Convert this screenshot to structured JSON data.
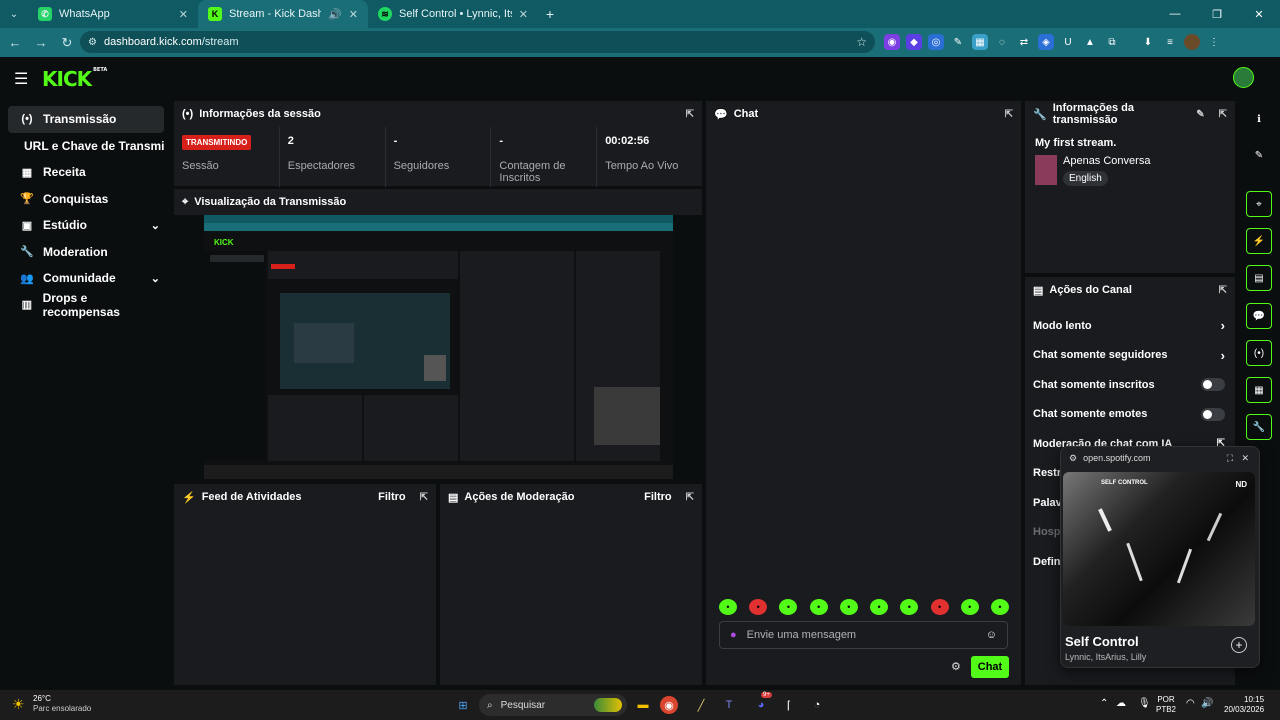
{
  "browser": {
    "tabs": [
      {
        "title": "WhatsApp",
        "icon": "whatsapp-icon",
        "color": "#25d366"
      },
      {
        "title": "Stream - Kick Dashboard",
        "icon": "kick-icon",
        "color": "#53fc18"
      },
      {
        "title": "Self Control • Lynnic, ItsAriu",
        "icon": "spotify-icon",
        "color": "#1ed760"
      }
    ],
    "new_tab": "+",
    "url_host": "dashboard.kick.com",
    "url_path": "/stream"
  },
  "header": {
    "logo": "KICK",
    "logo_badge": "BETA"
  },
  "sidebar": {
    "items": [
      {
        "label": "Transmissão",
        "icon": "(•)"
      },
      {
        "label": "URL e Chave de Transmissão",
        "icon": ""
      },
      {
        "label": "Receita",
        "icon": "▦"
      },
      {
        "label": "Conquistas",
        "icon": "🏆"
      },
      {
        "label": "Estúdio",
        "icon": "▣",
        "chevron": "⌄"
      },
      {
        "label": "Moderation",
        "icon": "🔧"
      },
      {
        "label": "Comunidade",
        "icon": "👥",
        "chevron": "⌄"
      },
      {
        "label": "Drops e recompensas",
        "icon": "▥"
      }
    ]
  },
  "session": {
    "title": "Informações da sessão",
    "live_badge": "TRANSMITINDO",
    "stats": [
      {
        "value": "",
        "label": "Sessão"
      },
      {
        "value": "2",
        "label": "Espectadores"
      },
      {
        "value": "-",
        "label": "Seguidores"
      },
      {
        "value": "-",
        "label": "Contagem de Inscritos"
      },
      {
        "value": "00:02:56",
        "label": "Tempo Ao Vivo"
      }
    ]
  },
  "preview": {
    "title": "Visualização da Transmissão"
  },
  "activity": {
    "title": "Feed de Atividades",
    "filter": "Filtro"
  },
  "moderation_actions": {
    "title": "Ações de Moderação",
    "filter": "Filtro"
  },
  "chat": {
    "title": "Chat",
    "placeholder": "Envie uma mensagem",
    "send": "Chat",
    "emotes": [
      {
        "c": "#53fc18"
      },
      {
        "c": "#e03030"
      },
      {
        "c": "#53fc18"
      },
      {
        "c": "#53fc18"
      },
      {
        "c": "#53fc18"
      },
      {
        "c": "#53fc18"
      },
      {
        "c": "#53fc18"
      },
      {
        "c": "#e03030"
      },
      {
        "c": "#53fc18"
      },
      {
        "c": "#53fc18"
      }
    ]
  },
  "stream_info": {
    "title": "Informações da transmissão",
    "stream_title": "My first stream.",
    "category": "Apenas Conversa",
    "language": "English"
  },
  "channel_actions": {
    "title": "Ações do Canal",
    "rows": [
      {
        "label": "Modo lento",
        "control": "chevron"
      },
      {
        "label": "Chat somente seguidores",
        "control": "chevron"
      },
      {
        "label": "Chat somente inscritos",
        "control": "toggle"
      },
      {
        "label": "Chat somente emotes",
        "control": "toggle"
      },
      {
        "label": "Moderação de chat com IA",
        "control": "link"
      },
      {
        "label": "Restri",
        "control": ""
      },
      {
        "label": "Palavr",
        "control": ""
      },
      {
        "label": "Hospe",
        "control": "",
        "muted": true
      },
      {
        "label": "Defini",
        "control": ""
      }
    ]
  },
  "spotify": {
    "domain": "open.spotify.com",
    "album_text": "SELF CONTROL",
    "album_tag": "ND",
    "track": "Self Control",
    "artists": "Lynnic, ItsArius, Lilly"
  },
  "taskbar": {
    "weather_temp": "26°C",
    "weather_desc": "Parc ensolarado",
    "search": "Pesquisar",
    "lang1": "POR",
    "lang2": "PTB2",
    "time": "10:15",
    "date": "20/03/2026",
    "discord_badge": "9+"
  }
}
